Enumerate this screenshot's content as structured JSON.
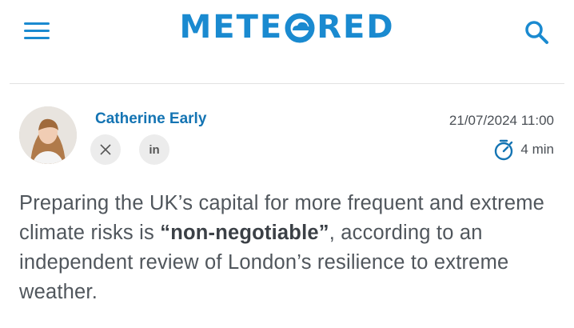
{
  "header": {
    "logo_text_left": "METE",
    "logo_text_right": "RED",
    "brand_color": "#1a8ad0"
  },
  "article": {
    "author_name": "Catherine Early",
    "date": "21/07/2024 11:00",
    "read_time": "4 min",
    "social": {
      "x_icon": "x-icon",
      "linkedin_label": "in"
    },
    "lead": {
      "part1": "Preparing the UK’s capital for more frequent and extreme climate risks is ",
      "emphasis": "“non-negotiable”",
      "part2": ", according to an independent review of London’s resilience to extreme weather."
    },
    "accent_color": "#1474b3"
  }
}
